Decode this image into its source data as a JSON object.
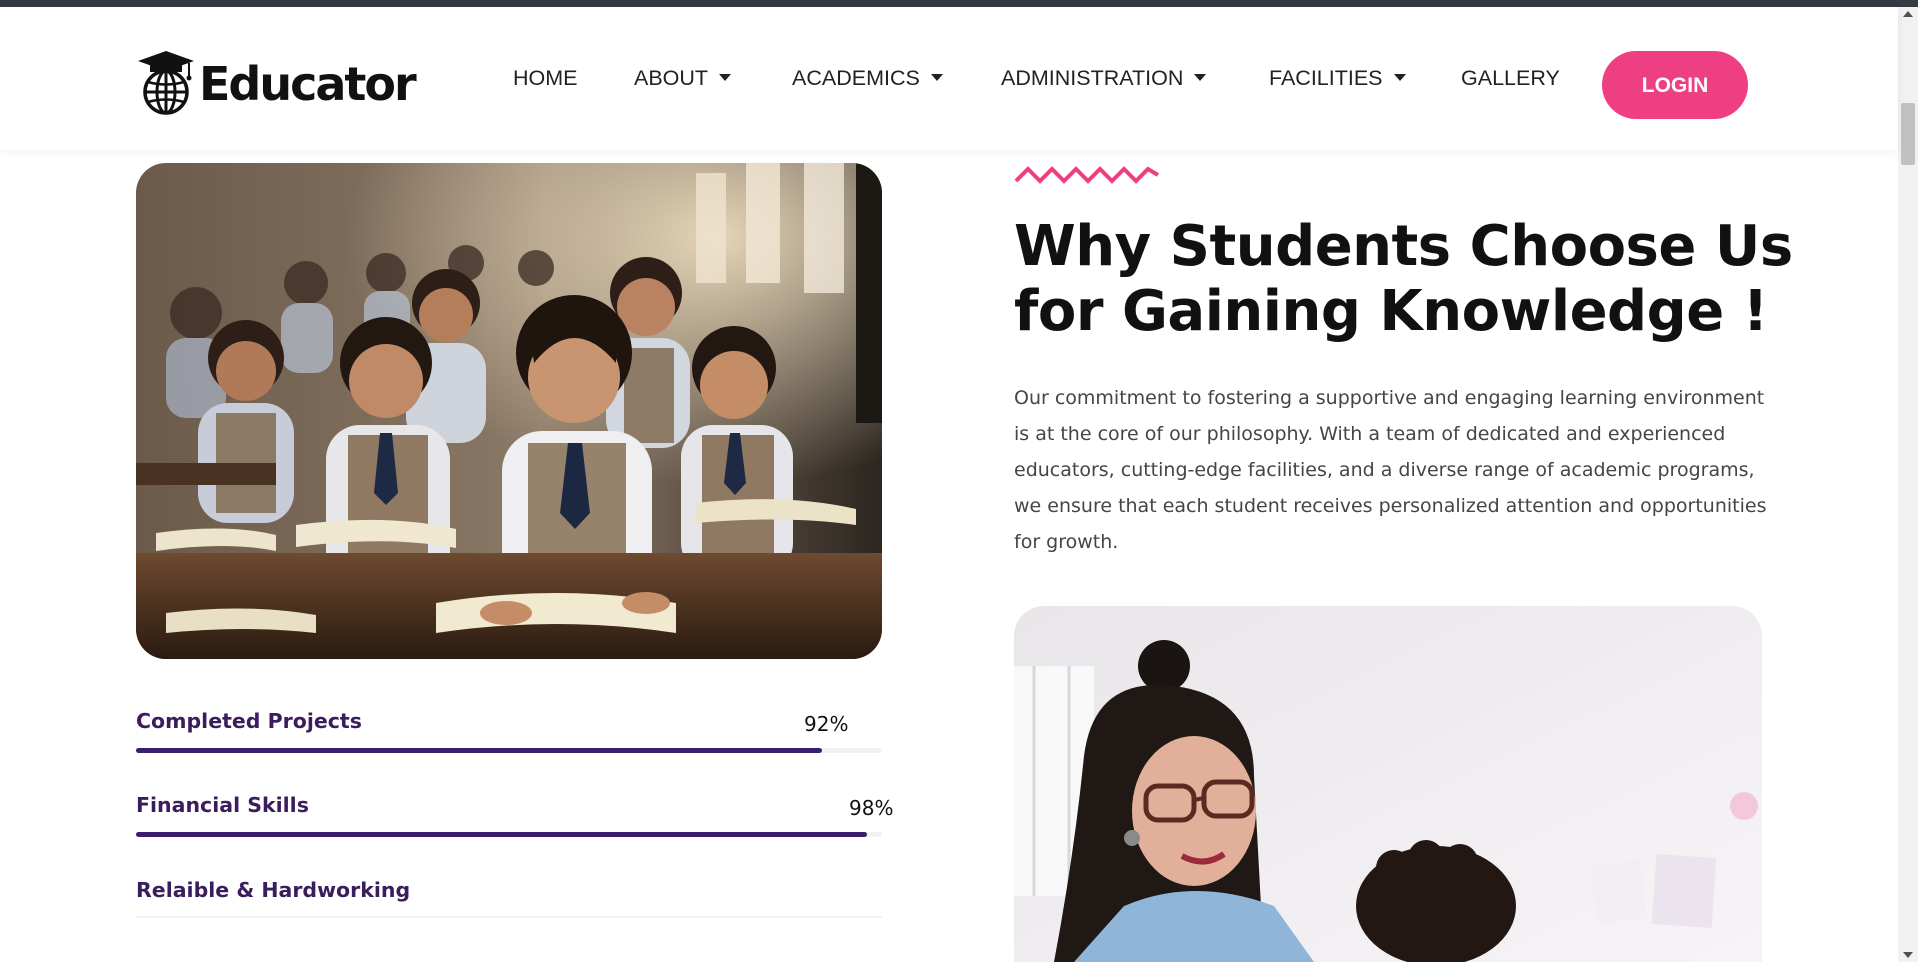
{
  "brand": {
    "name": "Educator",
    "icon": "graduation-globe-icon"
  },
  "nav": {
    "items": [
      {
        "label": "HOME",
        "dropdown": false
      },
      {
        "label": "ABOUT",
        "dropdown": true
      },
      {
        "label": "ACADEMICS",
        "dropdown": true
      },
      {
        "label": "ADMINISTRATION",
        "dropdown": true
      },
      {
        "label": "FACILITIES",
        "dropdown": true
      },
      {
        "label": "GALLERY",
        "dropdown": false
      }
    ],
    "login_label": "LOGIN"
  },
  "skills": [
    {
      "label": "Completed Projects",
      "percent_text": "92%",
      "percent": 92
    },
    {
      "label": "Financial Skills",
      "percent_text": "98%",
      "percent": 98
    },
    {
      "label": "Relaible & Hardworking",
      "percent_text": "",
      "percent": null
    }
  ],
  "section": {
    "heading_line1": "Why Students Choose Us",
    "heading_line2": "for Gaining Knowledge !",
    "paragraph": "Our commitment to fostering a supportive and engaging learning environment is at the core of our philosophy. With a team of dedicated and experienced educators, cutting-edge facilities, and a diverse range of academic programs, we ensure that each student receives personalized attention and opportunities for growth."
  },
  "colors": {
    "accent_pink": "#ee3f83",
    "skill_purple": "#3b1d6e",
    "heading": "#111111",
    "topbar": "#333a44"
  }
}
